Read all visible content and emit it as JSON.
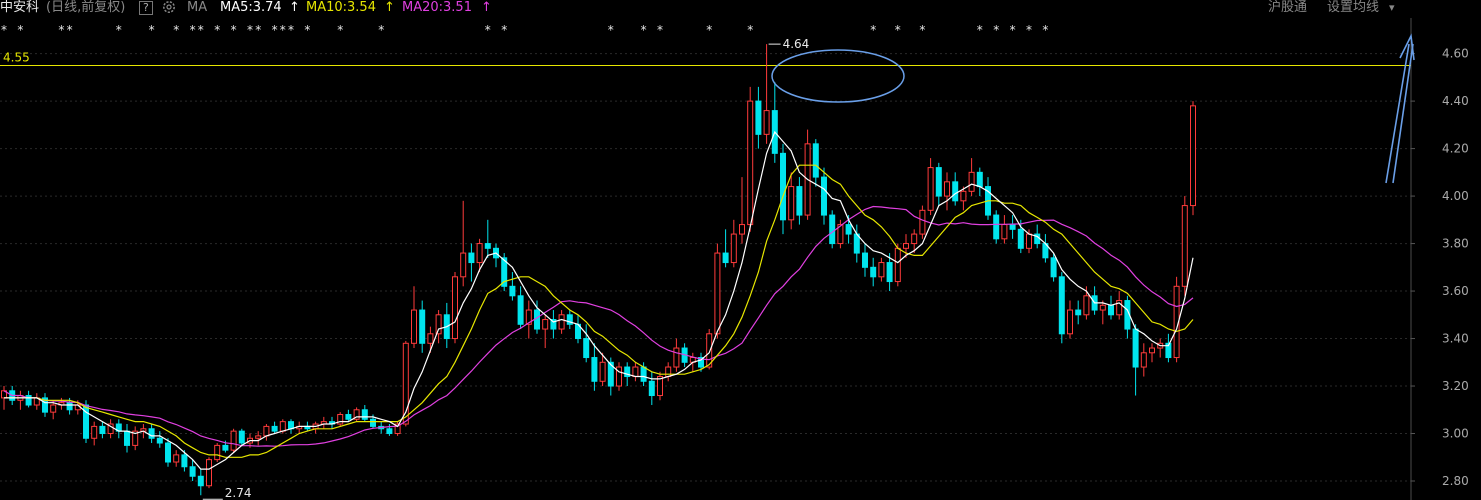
{
  "header": {
    "stock_name": "中安科",
    "period_label": "(日线,前复权)",
    "help_label": "?",
    "gear_icon": "gear-icon",
    "ma_label": "MA",
    "ma5": "MA5:3.74",
    "ma10": "MA10:3.54",
    "ma20": "MA20:3.51",
    "arrow": "↑",
    "hgt_label": "沪股通",
    "settings_label": "设置均线",
    "dropdown_icon": "▾"
  },
  "colors": {
    "background": "#000000",
    "up": "#ff3b3b",
    "down": "#00e5ee",
    "ma5": "#ffffff",
    "ma10": "#e6e600",
    "ma20": "#e040e0",
    "hline": "#e6e600",
    "annotation": "#6a9fe8",
    "marker": "#e8e8e8"
  },
  "chart_data": {
    "type": "candlestick",
    "ylim": [
      2.72,
      4.75
    ],
    "yticks": [
      "4.60",
      "4.40",
      "4.20",
      "4.00",
      "3.80",
      "3.60",
      "3.40",
      "3.20",
      "3.00",
      "2.80"
    ],
    "hline": {
      "value": 4.55,
      "label": "4.55"
    },
    "annotations": {
      "high": "4.64",
      "low": "2.74"
    },
    "marker_symbol": "*",
    "candles_ohlc": [
      [
        3.15,
        3.2,
        3.1,
        3.18
      ],
      [
        3.18,
        3.2,
        3.12,
        3.14
      ],
      [
        3.14,
        3.18,
        3.1,
        3.16
      ],
      [
        3.16,
        3.18,
        3.11,
        3.12
      ],
      [
        3.12,
        3.17,
        3.1,
        3.15
      ],
      [
        3.15,
        3.17,
        3.07,
        3.09
      ],
      [
        3.09,
        3.14,
        3.06,
        3.12
      ],
      [
        3.12,
        3.15,
        3.1,
        3.13
      ],
      [
        3.13,
        3.15,
        3.08,
        3.1
      ],
      [
        3.1,
        3.14,
        3.08,
        3.12
      ],
      [
        3.12,
        3.14,
        2.96,
        2.98
      ],
      [
        2.98,
        3.05,
        2.95,
        3.03
      ],
      [
        3.03,
        3.05,
        2.98,
        3.0
      ],
      [
        3.0,
        3.06,
        2.98,
        3.04
      ],
      [
        3.04,
        3.06,
        2.98,
        3.01
      ],
      [
        3.01,
        3.04,
        2.92,
        2.95
      ],
      [
        2.95,
        3.03,
        2.93,
        3.01
      ],
      [
        3.01,
        3.04,
        2.98,
        3.02
      ],
      [
        3.02,
        3.04,
        2.96,
        2.98
      ],
      [
        2.98,
        3.01,
        2.94,
        2.96
      ],
      [
        2.96,
        2.98,
        2.86,
        2.88
      ],
      [
        2.88,
        2.93,
        2.86,
        2.91
      ],
      [
        2.91,
        2.93,
        2.84,
        2.86
      ],
      [
        2.86,
        2.89,
        2.8,
        2.82
      ],
      [
        2.82,
        2.85,
        2.74,
        2.78
      ],
      [
        2.78,
        2.9,
        2.77,
        2.89
      ],
      [
        2.89,
        2.96,
        2.88,
        2.95
      ],
      [
        2.95,
        2.97,
        2.92,
        2.93
      ],
      [
        2.93,
        3.02,
        2.92,
        3.01
      ],
      [
        3.01,
        3.02,
        2.95,
        2.96
      ],
      [
        2.96,
        3.0,
        2.94,
        2.98
      ],
      [
        2.98,
        3.01,
        2.95,
        2.99
      ],
      [
        2.99,
        3.04,
        2.97,
        3.03
      ],
      [
        3.03,
        3.05,
        3.0,
        3.01
      ],
      [
        3.01,
        3.06,
        3.0,
        3.05
      ],
      [
        3.05,
        3.06,
        3.0,
        3.02
      ],
      [
        3.02,
        3.05,
        3.0,
        3.03
      ],
      [
        3.03,
        3.05,
        3.01,
        3.02
      ],
      [
        3.02,
        3.05,
        3.0,
        3.04
      ],
      [
        3.04,
        3.07,
        3.02,
        3.05
      ],
      [
        3.05,
        3.07,
        3.02,
        3.04
      ],
      [
        3.04,
        3.09,
        3.03,
        3.08
      ],
      [
        3.08,
        3.1,
        3.05,
        3.06
      ],
      [
        3.06,
        3.11,
        3.05,
        3.1
      ],
      [
        3.1,
        3.12,
        3.05,
        3.06
      ],
      [
        3.06,
        3.08,
        3.02,
        3.03
      ],
      [
        3.03,
        3.05,
        3.0,
        3.02
      ],
      [
        3.02,
        3.04,
        2.99,
        3.0
      ],
      [
        3.0,
        3.05,
        2.99,
        3.04
      ],
      [
        3.04,
        3.39,
        3.03,
        3.38
      ],
      [
        3.38,
        3.62,
        3.36,
        3.52
      ],
      [
        3.52,
        3.56,
        3.34,
        3.38
      ],
      [
        3.38,
        3.45,
        3.34,
        3.42
      ],
      [
        3.42,
        3.52,
        3.38,
        3.5
      ],
      [
        3.5,
        3.55,
        3.36,
        3.4
      ],
      [
        3.4,
        3.68,
        3.38,
        3.66
      ],
      [
        3.66,
        3.98,
        3.62,
        3.76
      ],
      [
        3.76,
        3.8,
        3.64,
        3.72
      ],
      [
        3.72,
        3.82,
        3.68,
        3.8
      ],
      [
        3.8,
        3.9,
        3.74,
        3.78
      ],
      [
        3.78,
        3.8,
        3.7,
        3.74
      ],
      [
        3.74,
        3.76,
        3.6,
        3.62
      ],
      [
        3.62,
        3.68,
        3.56,
        3.58
      ],
      [
        3.58,
        3.62,
        3.44,
        3.46
      ],
      [
        3.46,
        3.56,
        3.4,
        3.52
      ],
      [
        3.52,
        3.56,
        3.42,
        3.44
      ],
      [
        3.44,
        3.5,
        3.36,
        3.48
      ],
      [
        3.48,
        3.52,
        3.4,
        3.44
      ],
      [
        3.44,
        3.52,
        3.42,
        3.5
      ],
      [
        3.5,
        3.52,
        3.44,
        3.46
      ],
      [
        3.46,
        3.5,
        3.38,
        3.4
      ],
      [
        3.4,
        3.46,
        3.3,
        3.32
      ],
      [
        3.32,
        3.38,
        3.18,
        3.22
      ],
      [
        3.22,
        3.34,
        3.2,
        3.3
      ],
      [
        3.3,
        3.32,
        3.16,
        3.2
      ],
      [
        3.2,
        3.3,
        3.18,
        3.28
      ],
      [
        3.28,
        3.3,
        3.2,
        3.24
      ],
      [
        3.24,
        3.3,
        3.22,
        3.28
      ],
      [
        3.28,
        3.3,
        3.2,
        3.22
      ],
      [
        3.22,
        3.26,
        3.12,
        3.16
      ],
      [
        3.16,
        3.26,
        3.14,
        3.24
      ],
      [
        3.24,
        3.3,
        3.22,
        3.28
      ],
      [
        3.28,
        3.4,
        3.26,
        3.36
      ],
      [
        3.36,
        3.38,
        3.28,
        3.3
      ],
      [
        3.3,
        3.34,
        3.26,
        3.32
      ],
      [
        3.32,
        3.34,
        3.26,
        3.28
      ],
      [
        3.28,
        3.44,
        3.27,
        3.42
      ],
      [
        3.42,
        3.8,
        3.4,
        3.76
      ],
      [
        3.76,
        3.86,
        3.7,
        3.72
      ],
      [
        3.72,
        3.9,
        3.7,
        3.84
      ],
      [
        3.84,
        4.08,
        3.8,
        3.88
      ],
      [
        3.88,
        4.46,
        3.85,
        4.4
      ],
      [
        4.4,
        4.46,
        4.2,
        4.26
      ],
      [
        4.26,
        4.64,
        4.22,
        4.36
      ],
      [
        4.36,
        4.48,
        4.14,
        4.18
      ],
      [
        4.18,
        4.22,
        3.84,
        3.9
      ],
      [
        3.9,
        4.1,
        3.86,
        4.04
      ],
      [
        4.04,
        4.08,
        3.88,
        3.92
      ],
      [
        3.92,
        4.28,
        3.9,
        4.22
      ],
      [
        4.22,
        4.24,
        4.04,
        4.08
      ],
      [
        4.08,
        4.12,
        3.88,
        3.92
      ],
      [
        3.92,
        3.94,
        3.78,
        3.8
      ],
      [
        3.8,
        3.9,
        3.78,
        3.88
      ],
      [
        3.88,
        3.92,
        3.8,
        3.84
      ],
      [
        3.84,
        3.88,
        3.72,
        3.76
      ],
      [
        3.76,
        3.8,
        3.66,
        3.7
      ],
      [
        3.7,
        3.74,
        3.62,
        3.66
      ],
      [
        3.66,
        3.74,
        3.64,
        3.72
      ],
      [
        3.72,
        3.76,
        3.6,
        3.64
      ],
      [
        3.64,
        3.8,
        3.62,
        3.78
      ],
      [
        3.78,
        3.84,
        3.74,
        3.8
      ],
      [
        3.8,
        3.86,
        3.76,
        3.84
      ],
      [
        3.84,
        3.96,
        3.82,
        3.94
      ],
      [
        3.94,
        4.16,
        3.92,
        4.12
      ],
      [
        4.12,
        4.14,
        3.96,
        4.0
      ],
      [
        4.0,
        4.1,
        3.94,
        4.06
      ],
      [
        4.06,
        4.1,
        3.96,
        3.98
      ],
      [
        3.98,
        4.04,
        3.94,
        4.02
      ],
      [
        4.02,
        4.16,
        4.0,
        4.1
      ],
      [
        4.1,
        4.12,
        4.0,
        4.04
      ],
      [
        4.04,
        4.08,
        3.9,
        3.92
      ],
      [
        3.92,
        3.94,
        3.8,
        3.82
      ],
      [
        3.82,
        3.92,
        3.8,
        3.88
      ],
      [
        3.88,
        3.92,
        3.82,
        3.86
      ],
      [
        3.86,
        3.9,
        3.76,
        3.78
      ],
      [
        3.78,
        3.86,
        3.76,
        3.84
      ],
      [
        3.84,
        3.88,
        3.78,
        3.8
      ],
      [
        3.8,
        3.84,
        3.72,
        3.74
      ],
      [
        3.74,
        3.76,
        3.64,
        3.66
      ],
      [
        3.66,
        3.68,
        3.38,
        3.42
      ],
      [
        3.42,
        3.56,
        3.4,
        3.52
      ],
      [
        3.52,
        3.56,
        3.46,
        3.5
      ],
      [
        3.5,
        3.62,
        3.48,
        3.58
      ],
      [
        3.58,
        3.62,
        3.5,
        3.52
      ],
      [
        3.52,
        3.56,
        3.46,
        3.54
      ],
      [
        3.54,
        3.58,
        3.48,
        3.5
      ],
      [
        3.5,
        3.6,
        3.48,
        3.56
      ],
      [
        3.56,
        3.58,
        3.4,
        3.44
      ],
      [
        3.44,
        3.46,
        3.16,
        3.28
      ],
      [
        3.28,
        3.38,
        3.24,
        3.34
      ],
      [
        3.34,
        3.38,
        3.3,
        3.36
      ],
      [
        3.36,
        3.4,
        3.32,
        3.38
      ],
      [
        3.38,
        3.42,
        3.3,
        3.32
      ],
      [
        3.32,
        3.66,
        3.3,
        3.62
      ],
      [
        3.62,
        4.0,
        3.58,
        3.96
      ],
      [
        3.96,
        4.4,
        3.92,
        4.38
      ]
    ],
    "ma5": [
      3.15,
      3.15,
      3.15,
      3.15,
      3.15,
      3.13,
      3.13,
      3.12,
      3.12,
      3.12,
      3.09,
      3.07,
      3.05,
      3.03,
      3.01,
      3.01,
      3.0,
      3.01,
      2.99,
      2.99,
      2.97,
      2.95,
      2.92,
      2.89,
      2.85,
      2.85,
      2.87,
      2.89,
      2.92,
      2.95,
      2.97,
      2.97,
      2.99,
      3.0,
      3.01,
      3.02,
      3.03,
      3.03,
      3.03,
      3.04,
      3.04,
      3.05,
      3.05,
      3.07,
      3.07,
      3.07,
      3.06,
      3.05,
      3.03,
      3.09,
      3.19,
      3.26,
      3.35,
      3.44,
      3.45,
      3.47,
      3.55,
      3.61,
      3.69,
      3.75,
      3.76,
      3.73,
      3.7,
      3.64,
      3.58,
      3.53,
      3.5,
      3.47,
      3.48,
      3.47,
      3.46,
      3.42,
      3.37,
      3.33,
      3.29,
      3.26,
      3.25,
      3.24,
      3.24,
      3.23,
      3.23,
      3.24,
      3.25,
      3.27,
      3.3,
      3.31,
      3.34,
      3.43,
      3.5,
      3.6,
      3.72,
      3.87,
      4.03,
      4.18,
      4.27,
      4.23,
      4.19,
      4.1,
      4.07,
      4.05,
      4.03,
      3.99,
      3.98,
      3.9,
      3.84,
      3.8,
      3.77,
      3.76,
      3.74,
      3.72,
      3.75,
      3.77,
      3.8,
      3.88,
      3.96,
      3.98,
      4.01,
      4.03,
      4.05,
      4.04,
      4.02,
      3.99,
      3.96,
      3.93,
      3.87,
      3.84,
      3.83,
      3.8,
      3.76,
      3.69,
      3.65,
      3.62,
      3.6,
      3.55,
      3.55,
      3.54,
      3.55,
      3.52,
      3.44,
      3.42,
      3.39,
      3.37,
      3.37,
      3.44,
      3.57,
      3.74
    ],
    "ma10": [
      3.15,
      3.15,
      3.15,
      3.15,
      3.15,
      3.14,
      3.14,
      3.14,
      3.14,
      3.13,
      3.11,
      3.1,
      3.09,
      3.08,
      3.07,
      3.06,
      3.05,
      3.05,
      3.04,
      3.03,
      3.01,
      2.99,
      2.96,
      2.94,
      2.92,
      2.91,
      2.91,
      2.9,
      2.9,
      2.9,
      2.91,
      2.91,
      2.92,
      2.94,
      2.96,
      2.98,
      3.0,
      3.01,
      3.02,
      3.02,
      3.02,
      3.03,
      3.04,
      3.05,
      3.05,
      3.05,
      3.05,
      3.05,
      3.05,
      3.07,
      3.1,
      3.13,
      3.17,
      3.21,
      3.24,
      3.3,
      3.37,
      3.44,
      3.52,
      3.59,
      3.61,
      3.64,
      3.65,
      3.66,
      3.66,
      3.64,
      3.62,
      3.58,
      3.55,
      3.52,
      3.5,
      3.47,
      3.43,
      3.41,
      3.38,
      3.35,
      3.33,
      3.3,
      3.28,
      3.26,
      3.25,
      3.25,
      3.25,
      3.25,
      3.26,
      3.27,
      3.29,
      3.33,
      3.37,
      3.42,
      3.49,
      3.58,
      3.68,
      3.81,
      3.9,
      4.0,
      4.09,
      4.13,
      4.13,
      4.13,
      4.1,
      4.07,
      4.05,
      4.0,
      3.96,
      3.92,
      3.9,
      3.87,
      3.83,
      3.78,
      3.76,
      3.75,
      3.75,
      3.79,
      3.83,
      3.87,
      3.91,
      3.93,
      3.96,
      3.97,
      3.98,
      3.98,
      3.97,
      3.97,
      3.96,
      3.93,
      3.91,
      3.89,
      3.86,
      3.84,
      3.8,
      3.76,
      3.72,
      3.68,
      3.65,
      3.62,
      3.61,
      3.59,
      3.55,
      3.51,
      3.47,
      3.46,
      3.44,
      3.43,
      3.44,
      3.48,
      3.54
    ]
  }
}
